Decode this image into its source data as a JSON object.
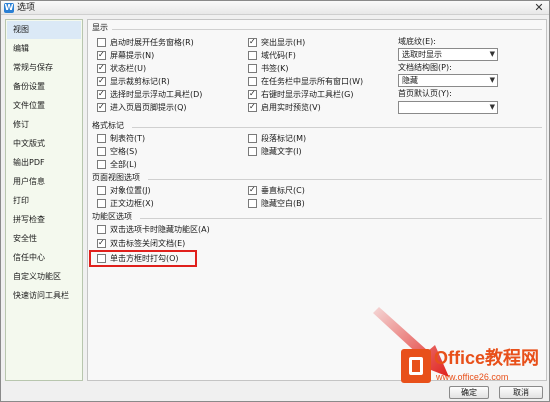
{
  "window": {
    "title": "选项",
    "app_icon": "W",
    "close_glyph": "✕"
  },
  "sidebar": {
    "items": [
      {
        "label": "视图",
        "selected": true
      },
      {
        "label": "编辑",
        "selected": false
      },
      {
        "label": "常规与保存",
        "selected": false
      },
      {
        "label": "备份设置",
        "selected": false
      },
      {
        "label": "文件位置",
        "selected": false
      },
      {
        "label": "修订",
        "selected": false
      },
      {
        "label": "中文版式",
        "selected": false
      },
      {
        "label": "输出PDF",
        "selected": false
      },
      {
        "label": "用户信息",
        "selected": false
      },
      {
        "label": "打印",
        "selected": false
      },
      {
        "label": "拼写检查",
        "selected": false
      },
      {
        "label": "安全性",
        "selected": false
      },
      {
        "label": "信任中心",
        "selected": false
      },
      {
        "label": "自定义功能区",
        "selected": false
      },
      {
        "label": "快速访问工具栏",
        "selected": false
      }
    ]
  },
  "sections": {
    "display": {
      "title": "显示",
      "col1": [
        {
          "label": "启动时展开任务窗格(R)",
          "checked": false
        },
        {
          "label": "屏幕提示(N)",
          "checked": true
        },
        {
          "label": "状态栏(U)",
          "checked": true
        },
        {
          "label": "显示裁剪标记(R)",
          "checked": true
        },
        {
          "label": "选择时显示浮动工具栏(D)",
          "checked": true
        },
        {
          "label": "进入页眉页脚提示(Q)",
          "checked": true
        }
      ],
      "col2": [
        {
          "label": "突出显示(H)",
          "checked": true
        },
        {
          "label": "域代码(F)",
          "checked": false
        },
        {
          "label": "书签(K)",
          "checked": false
        },
        {
          "label": "在任务栏中显示所有窗口(W)",
          "checked": false
        },
        {
          "label": "右键时显示浮动工具栏(G)",
          "checked": true
        },
        {
          "label": "启用实时预览(V)",
          "checked": true
        }
      ],
      "field_shading_label": "域底纹(E):",
      "field_shading_value": "选取时显示",
      "doc_map_label": "文档结构图(P):",
      "doc_map_value": "隐藏",
      "first_page_label": "首页默认页(Y):",
      "first_page_value": ""
    },
    "formatting_marks": {
      "title": "格式标记",
      "col1": [
        {
          "label": "制表符(T)",
          "checked": false
        },
        {
          "label": "空格(S)",
          "checked": false
        },
        {
          "label": "全部(L)",
          "checked": false
        }
      ],
      "col2": [
        {
          "label": "段落标记(M)",
          "checked": false
        },
        {
          "label": "隐藏文字(I)",
          "checked": false
        }
      ]
    },
    "page_view": {
      "title": "页面视图选项",
      "col1": [
        {
          "label": "对象位置(J)",
          "checked": false
        },
        {
          "label": "正文边框(X)",
          "checked": false
        }
      ],
      "col2": [
        {
          "label": "垂直标尺(C)",
          "checked": true
        },
        {
          "label": "隐藏空白(B)",
          "checked": false
        }
      ]
    },
    "ribbon": {
      "title": "功能区选项",
      "items": [
        {
          "label": "双击选项卡时隐藏功能区(A)",
          "checked": false
        },
        {
          "label": "双击标签关闭文档(E)",
          "checked": true
        },
        {
          "label": "单击方框时打勾(O)",
          "checked": false
        }
      ]
    }
  },
  "buttons": {
    "ok": "确定",
    "cancel": "取消"
  },
  "watermark": {
    "title": "Office教程网",
    "url": "www.office26.com"
  },
  "colors": {
    "highlight": "#e0201c",
    "watermark": "#e8501a",
    "selected_bg": "#dbe9f6"
  }
}
